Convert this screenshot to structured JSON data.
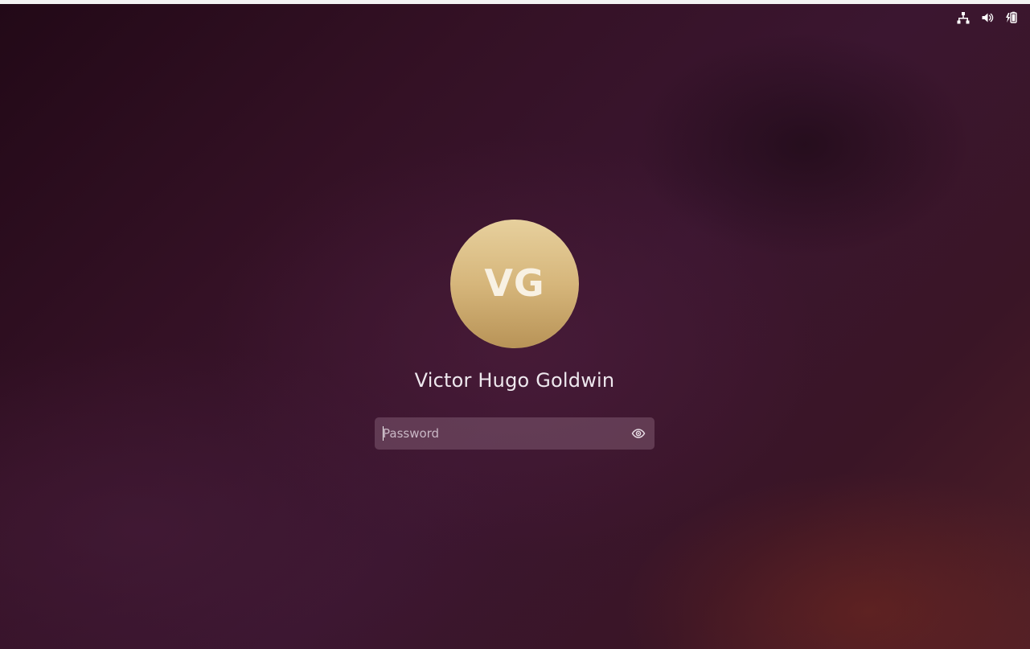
{
  "system_tray": {
    "icons": [
      {
        "name": "network-icon"
      },
      {
        "name": "volume-icon"
      },
      {
        "name": "battery-charging-icon"
      }
    ]
  },
  "login": {
    "avatar_initials": "VG",
    "user_name": "Victor Hugo Goldwin",
    "password": {
      "placeholder": "Password",
      "value": "",
      "reveal_icon": "eye-icon"
    }
  },
  "colors": {
    "background_primary": "#341125",
    "avatar_top": "#e7d09d",
    "avatar_bottom": "#b89357",
    "text_primary": "#eee8ee",
    "field_background": "#5a3b50"
  }
}
